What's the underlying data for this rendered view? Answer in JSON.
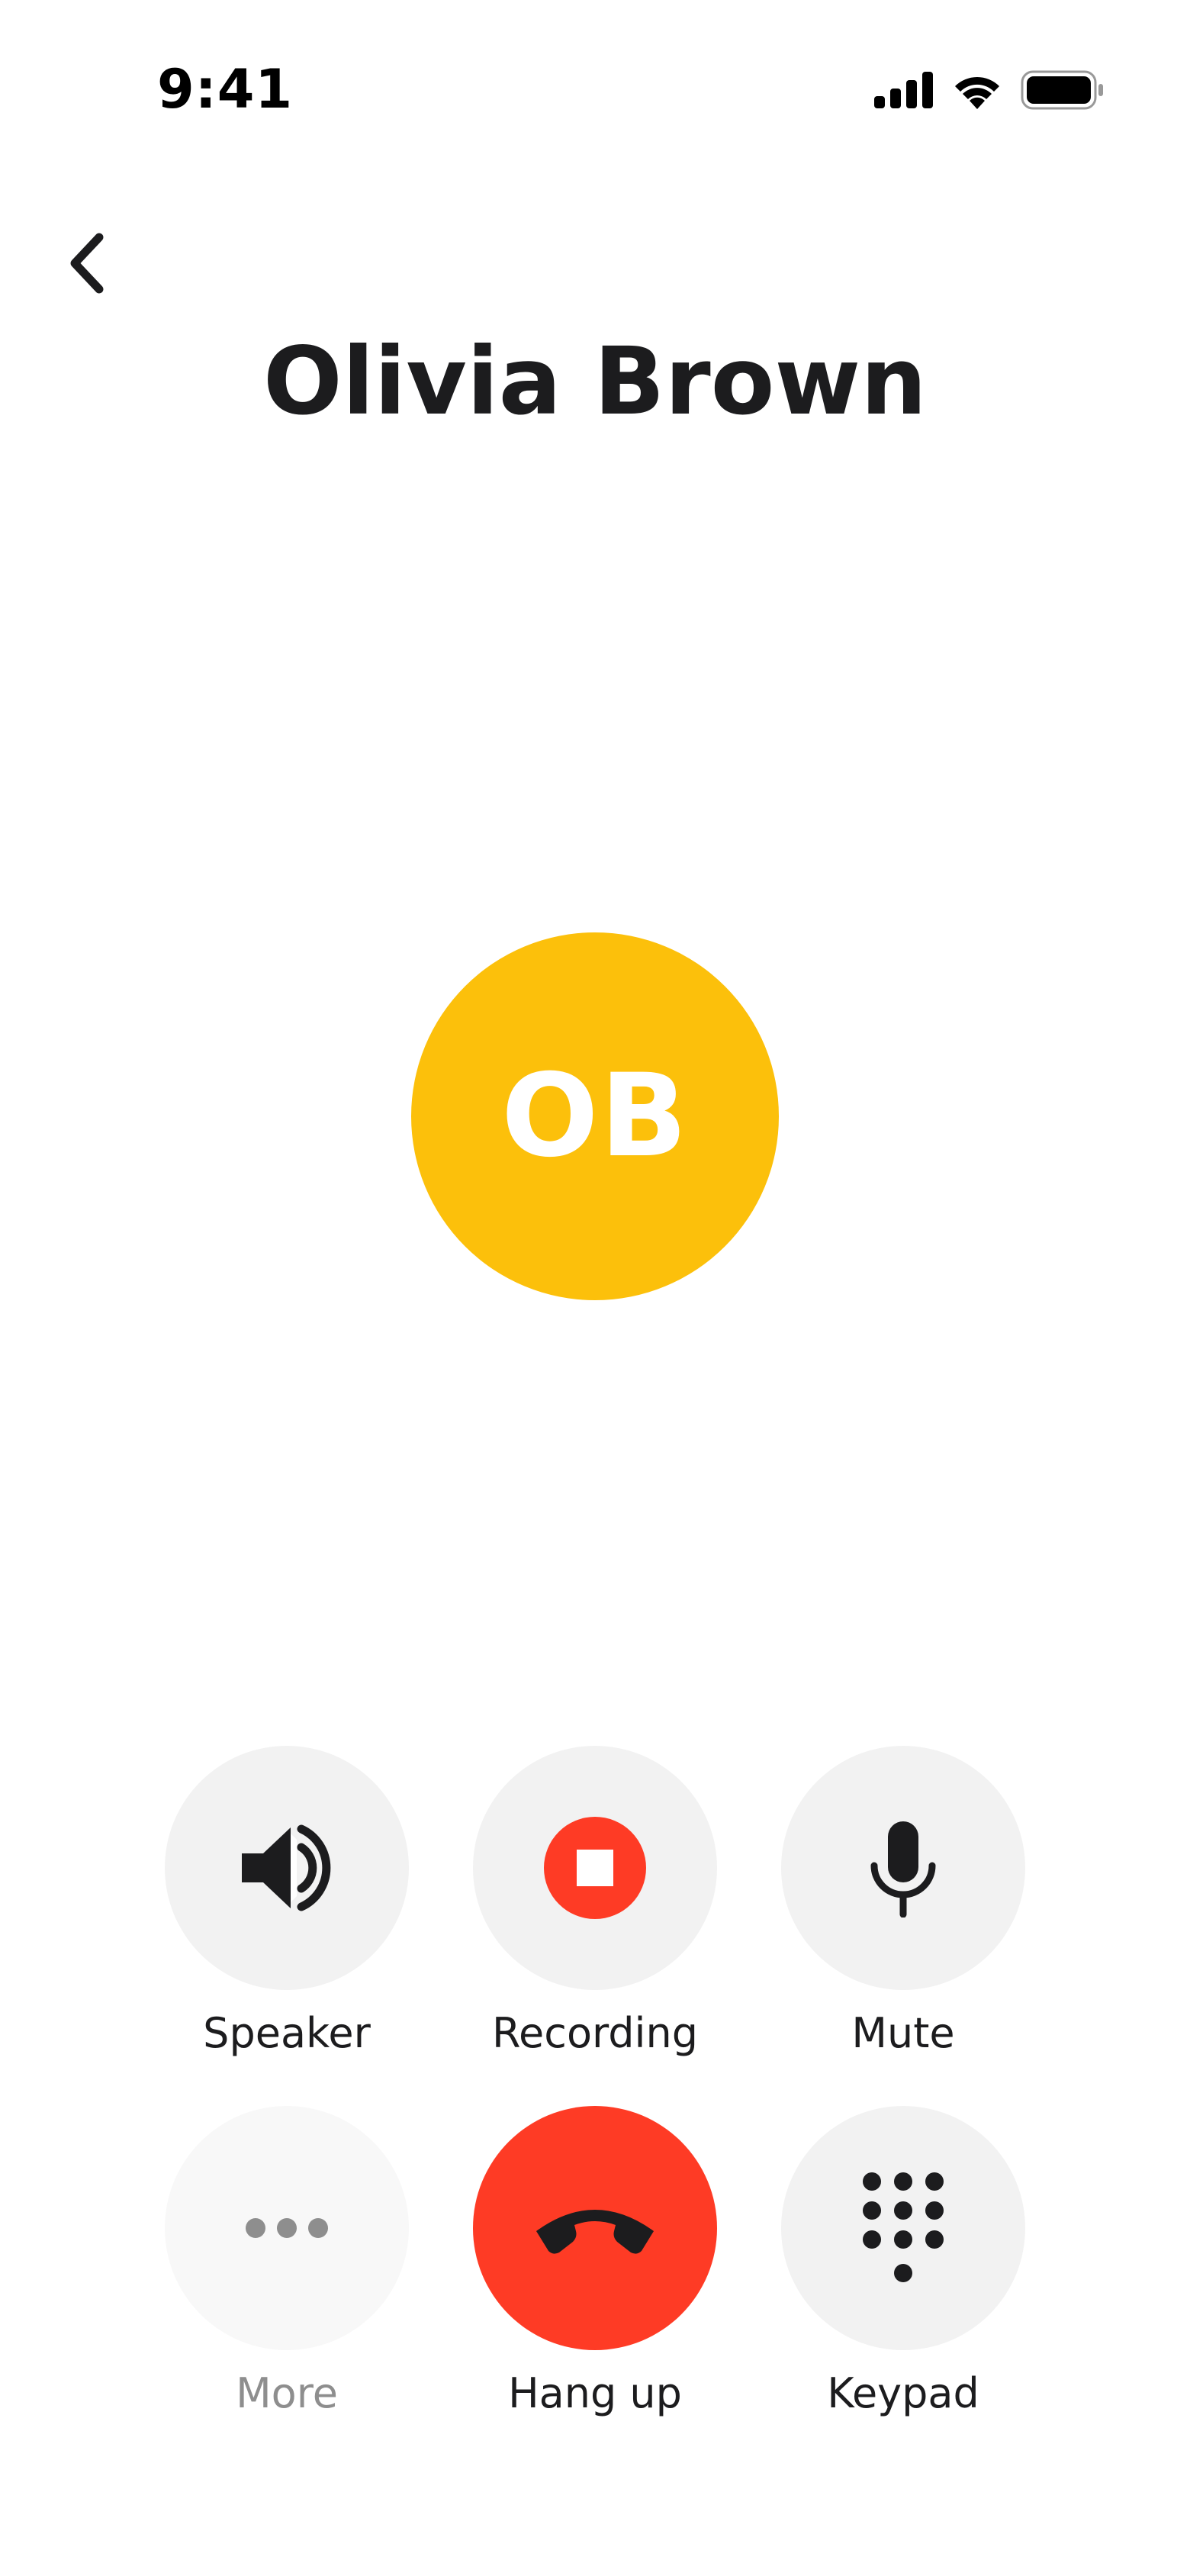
{
  "status_bar": {
    "time": "9:41",
    "icons": [
      "cellular-signal-icon",
      "wifi-icon",
      "battery-icon"
    ]
  },
  "header": {
    "back_icon": "chevron-left-icon",
    "contact_name": "Olivia Brown"
  },
  "avatar": {
    "initials": "OB",
    "color": "#FCC00B"
  },
  "controls": {
    "speaker": {
      "label": "Speaker",
      "icon": "speaker-icon"
    },
    "recording": {
      "label": "Recording",
      "icon": "stop-recording-icon",
      "accent": "#FE3B25"
    },
    "mute": {
      "label": "Mute",
      "icon": "microphone-icon"
    },
    "more": {
      "label": "More",
      "icon": "more-dots-icon",
      "disabled": true
    },
    "hang_up": {
      "label": "Hang up",
      "icon": "hang-up-phone-icon",
      "accent": "#FE3B25"
    },
    "keypad": {
      "label": "Keypad",
      "icon": "keypad-icon"
    }
  }
}
